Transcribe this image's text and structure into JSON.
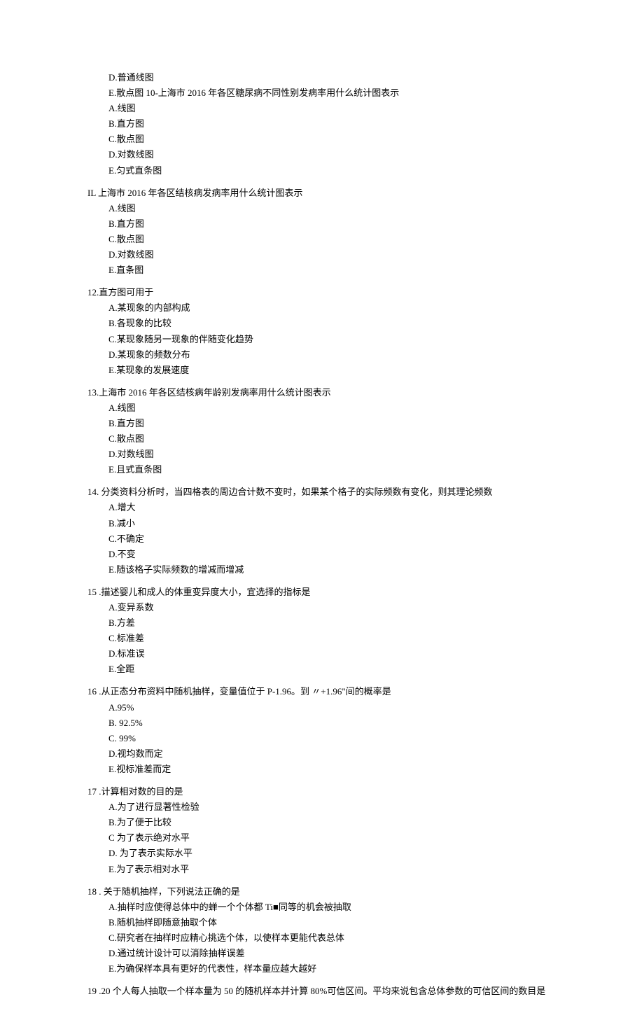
{
  "q9_tail": {
    "options": [
      "D.普通线图",
      "E.散点图 10-上海市 2016 年各区糖尿病不同性别发病率用什么统计图表示"
    ],
    "sub_options": [
      "A.线图",
      "B.直方图",
      "C.散点图",
      "D.对数线图",
      "E.匀式直条图"
    ]
  },
  "q11": {
    "stem": "IL 上海市 2016 年各区结核病发病率用什么统计图表示",
    "options": [
      "A.线图",
      "B.直方图",
      "C.散点图",
      "D.对数线图",
      "E.直条图"
    ]
  },
  "q12": {
    "stem": "12.直方图可用于",
    "options": [
      "A.某现象的内部构成",
      "B.各现象的比较",
      "C.某现象随另一现象的伴随变化趋势",
      "D.某现象的频数分布",
      "E.某现象的发展速度"
    ]
  },
  "q13": {
    "stem": "13.上海市 2016 年各区结核病年龄别发病率用什么统计图表示",
    "options": [
      "A.线图",
      "B.直方图",
      "C.散点图",
      "D.对数线图",
      "E.且式直条图"
    ]
  },
  "q14": {
    "stem": "14. 分类资料分析时，当四格表的周边合计数不变时，如果某个格子的实际频数有变化，则其理论频数",
    "options": [
      "A.增大",
      "B.减小",
      "C.不确定",
      "D.不变",
      "E.随该格子实际频数的增减而增减"
    ]
  },
  "q15": {
    "stem": "15   .描述婴儿和成人的体重变异度大小，宜选择的指标是",
    "options": [
      "A.变异系数",
      "B.方差",
      "C.标准差",
      "D.标准误",
      "E.全距"
    ]
  },
  "q16": {
    "stem": "16   .从正态分布资料中随机抽样，变量值位于 P-1.96。到 〃+1.96\"间的概率是",
    "options": [
      "A.95%",
      "B.    92.5%",
      "C.    99%",
      "D.视均数而定",
      "E.视标准差而定"
    ]
  },
  "q17": {
    "stem": "17   .计算相对数的目的是",
    "options": [
      "A.为了进行显著性检验",
      "B.为了便于比较",
      "C 为了表示绝对水平",
      "D. 为了表示实际水平",
      "E.为了表示相对水平"
    ]
  },
  "q18": {
    "stem": "18   . 关于随机抽样，下列说法正确的是",
    "options": [
      "A.抽样时应使得总体中的蝉一个个体都 Ti■同等的机会被抽取",
      "B.随机抽样即随意抽取个体",
      "C.研究者在抽样时应精心挑选个体，以使样本更能代表总体",
      "D.通过统计设计可以消除抽样误差",
      "E.为确保样本具有更好的代表性，样本量应越大越好"
    ]
  },
  "q19": {
    "stem": "19   .20 个人每人抽取一个样本量为 50 的随机样本并计算 80%可信区间。平均来说包含总体参数的可信区间的数目是"
  }
}
